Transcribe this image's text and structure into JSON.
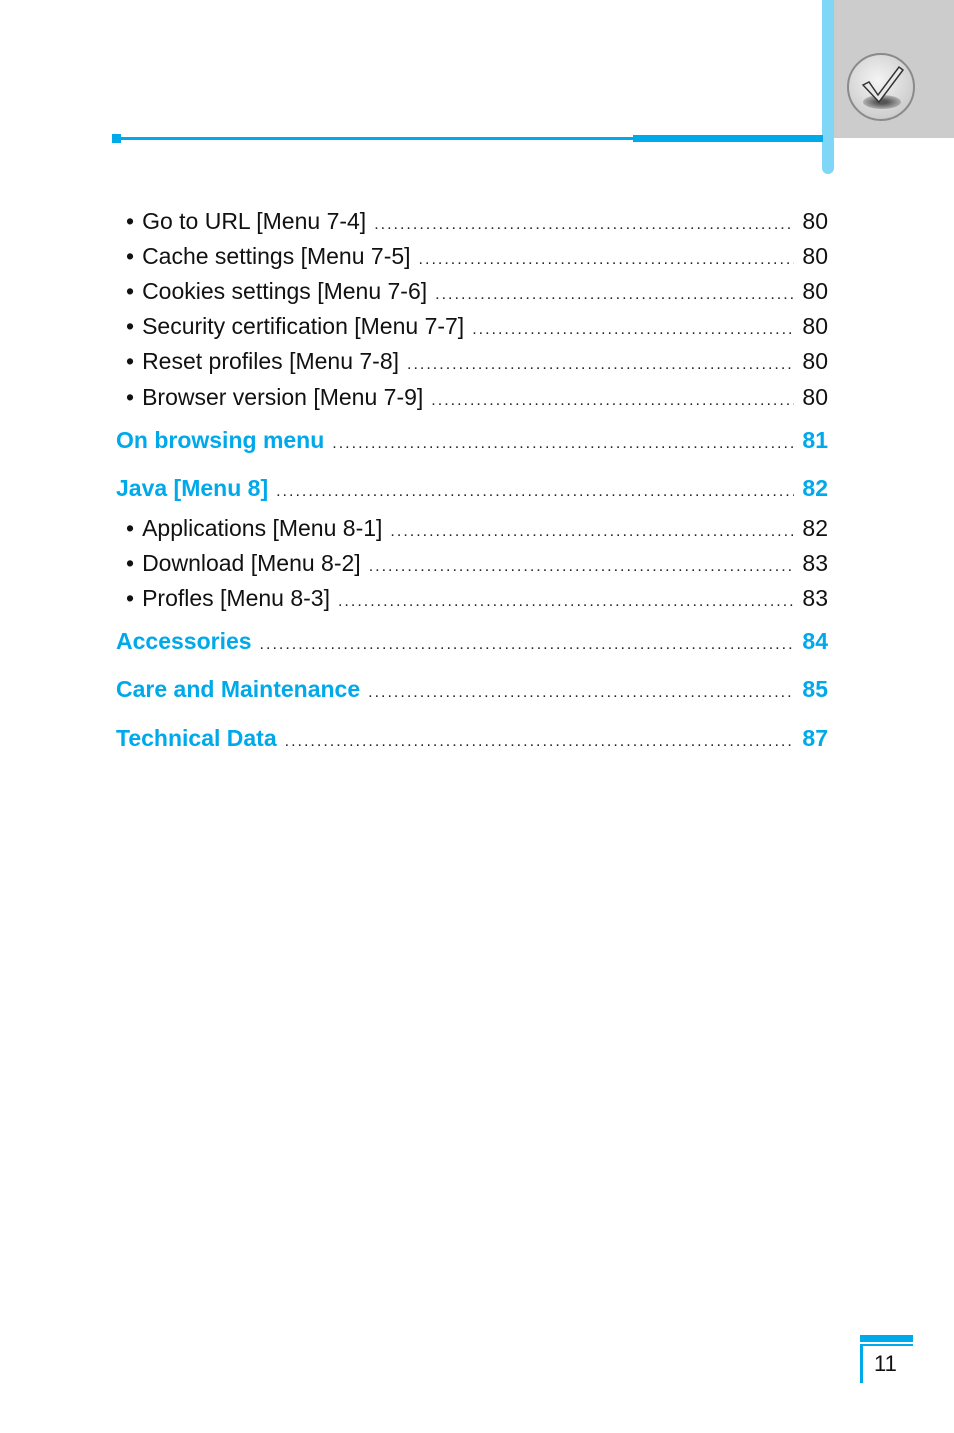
{
  "header": {
    "icon": "checkmark-badge-icon"
  },
  "toc": [
    {
      "type": "sub",
      "label": "Go to URL [Menu 7-4]",
      "page": "80"
    },
    {
      "type": "sub",
      "label": "Cache settings [Menu 7-5]",
      "page": "80"
    },
    {
      "type": "sub",
      "label": "Cookies settings [Menu 7-6]",
      "page": "80"
    },
    {
      "type": "sub",
      "label": "Security certification [Menu 7-7]",
      "page": "80"
    },
    {
      "type": "sub",
      "label": "Reset profiles [Menu 7-8]",
      "page": "80"
    },
    {
      "type": "sub",
      "label": "Browser version [Menu 7-9]",
      "page": "80"
    },
    {
      "type": "main",
      "label": "On browsing menu",
      "page": "81"
    },
    {
      "type": "main",
      "label": "Java [Menu 8]",
      "page": "82"
    },
    {
      "type": "sub",
      "label": "Applications [Menu 8-1]",
      "page": "82"
    },
    {
      "type": "sub",
      "label": "Download [Menu 8-2]",
      "page": "83"
    },
    {
      "type": "sub",
      "label": "Profles [Menu 8-3]",
      "page": "83"
    },
    {
      "type": "main",
      "label": "Accessories",
      "page": "84"
    },
    {
      "type": "main",
      "label": "Care and Maintenance",
      "page": "85"
    },
    {
      "type": "main",
      "label": "Technical Data",
      "page": "87"
    }
  ],
  "bullet": "•",
  "footer": {
    "page_number": "11"
  },
  "colors": {
    "accent": "#00a9e9",
    "accent_light": "#7fd6f6",
    "tab_gray": "#cccccc"
  }
}
